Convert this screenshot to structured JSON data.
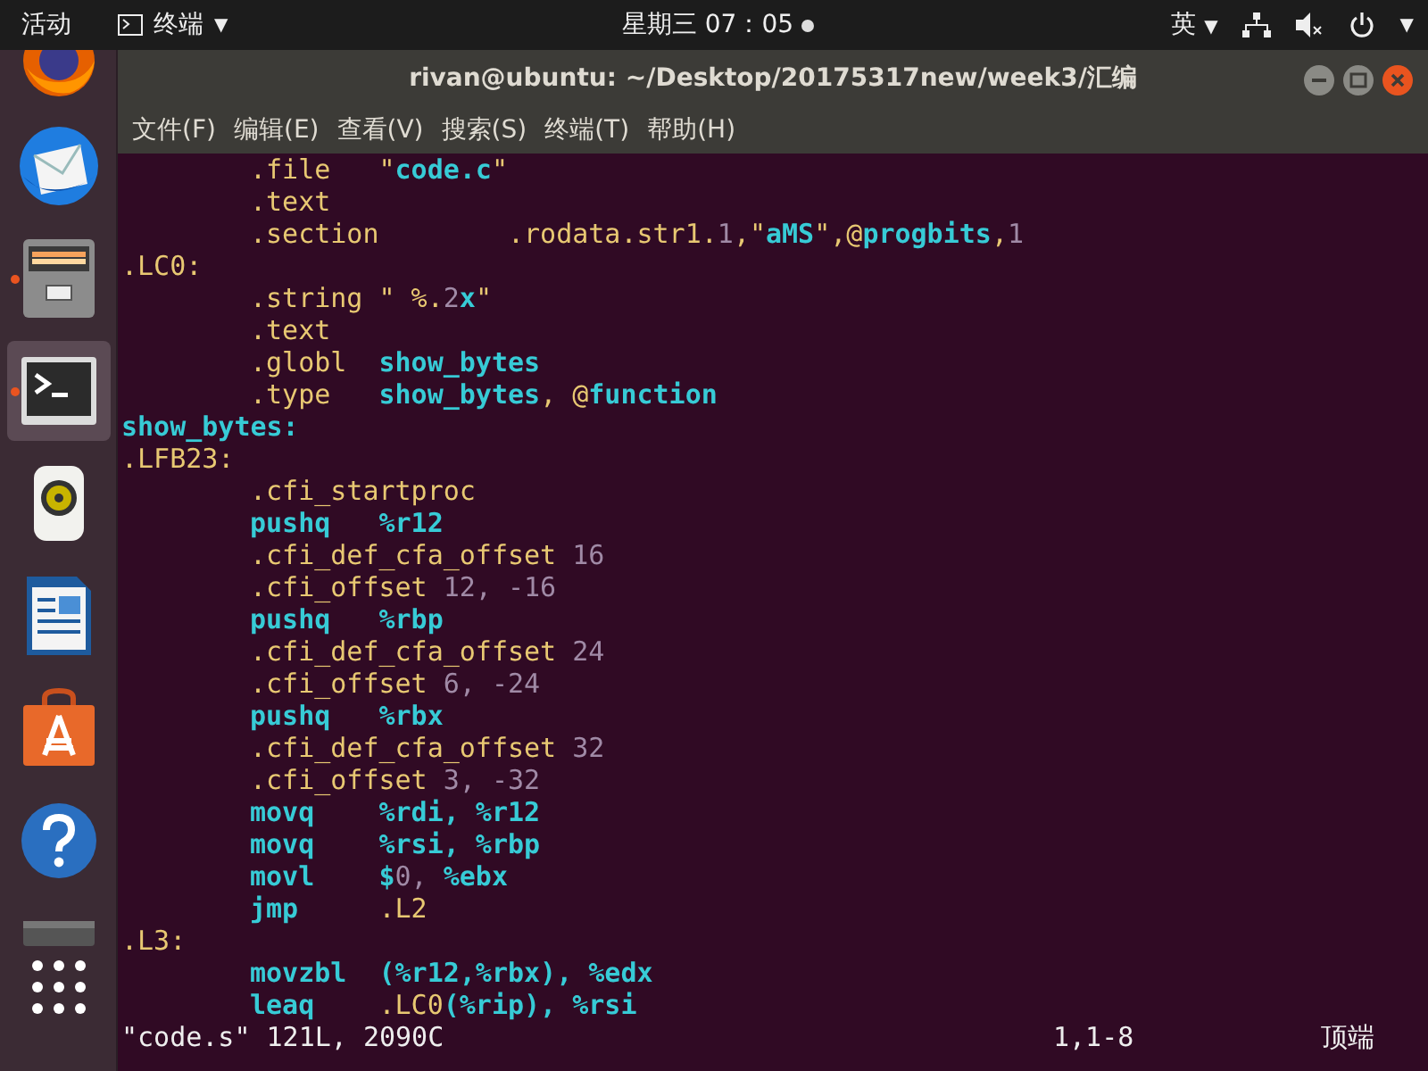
{
  "top_bar": {
    "activities": "活动",
    "app_menu": "终端",
    "app_menu_caret": "▼",
    "input_method_caret": "▼",
    "system_menu_caret": "▼",
    "clock": "星期三 07：05",
    "notification_dot": true,
    "input_method": "英"
  },
  "dock": [
    {
      "kind": "browser",
      "running": false,
      "selected": false
    },
    {
      "kind": "mail",
      "running": false,
      "selected": false
    },
    {
      "kind": "files",
      "running": true,
      "selected": false
    },
    {
      "kind": "terminal",
      "running": true,
      "selected": true
    },
    {
      "kind": "speaker",
      "running": false,
      "selected": false
    },
    {
      "kind": "document",
      "running": false,
      "selected": false
    },
    {
      "kind": "store",
      "running": false,
      "selected": false
    },
    {
      "kind": "help",
      "running": false,
      "selected": false
    },
    {
      "kind": "partial",
      "running": false,
      "selected": false
    },
    {
      "kind": "grid",
      "running": false,
      "selected": false
    }
  ],
  "window": {
    "title": "rivan@ubuntu: ~/Desktop/20175317new/week3/汇编",
    "menu": [
      "文件(F)",
      "编辑(E)",
      "查看(V)",
      "搜索(S)",
      "终端(T)",
      "帮助(H)"
    ],
    "lines": [
      {
        "indent": true,
        "segments": [
          {
            "text": ".file   \"",
            "kind": "directive"
          },
          {
            "text": "code.c",
            "kind": "ident"
          },
          {
            "text": "\"",
            "kind": "directive"
          }
        ]
      },
      {
        "indent": true,
        "segments": [
          {
            "text": ".text",
            "kind": "directive"
          }
        ]
      },
      {
        "indent": true,
        "segments": [
          {
            "text": ".section        .rodata.str1.",
            "kind": "directive"
          },
          {
            "text": "1",
            "kind": "number"
          },
          {
            "text": ",\"",
            "kind": "directive"
          },
          {
            "text": "aMS",
            "kind": "ident"
          },
          {
            "text": "\",@",
            "kind": "directive"
          },
          {
            "text": "progbits",
            "kind": "ident"
          },
          {
            "text": ",",
            "kind": "directive"
          },
          {
            "text": "1",
            "kind": "number"
          }
        ]
      },
      {
        "indent": false,
        "segments": [
          {
            "text": ".LC0:",
            "kind": "directive"
          }
        ]
      },
      {
        "indent": true,
        "segments": [
          {
            "text": ".string \" %.",
            "kind": "directive"
          },
          {
            "text": "2",
            "kind": "number"
          },
          {
            "text": "x",
            "kind": "ident"
          },
          {
            "text": "\"",
            "kind": "directive"
          }
        ]
      },
      {
        "indent": true,
        "segments": [
          {
            "text": ".text",
            "kind": "directive"
          }
        ]
      },
      {
        "indent": true,
        "segments": [
          {
            "text": ".globl  ",
            "kind": "directive"
          },
          {
            "text": "show_bytes",
            "kind": "ident"
          }
        ]
      },
      {
        "indent": true,
        "segments": [
          {
            "text": ".type   ",
            "kind": "directive"
          },
          {
            "text": "show_bytes",
            "kind": "ident"
          },
          {
            "text": ", @",
            "kind": "directive"
          },
          {
            "text": "function",
            "kind": "ident"
          }
        ]
      },
      {
        "indent": false,
        "segments": [
          {
            "text": "show_bytes:",
            "kind": "ident"
          }
        ]
      },
      {
        "indent": false,
        "segments": [
          {
            "text": ".LFB23:",
            "kind": "directive"
          }
        ]
      },
      {
        "indent": true,
        "segments": [
          {
            "text": ".cfi_startproc",
            "kind": "directive"
          }
        ]
      },
      {
        "indent": true,
        "segments": [
          {
            "text": "pushq   %r12",
            "kind": "ident"
          }
        ]
      },
      {
        "indent": true,
        "segments": [
          {
            "text": ".cfi_def_cfa_offset ",
            "kind": "directive"
          },
          {
            "text": "16",
            "kind": "number"
          }
        ]
      },
      {
        "indent": true,
        "segments": [
          {
            "text": ".cfi_offset ",
            "kind": "directive"
          },
          {
            "text": "12, -16",
            "kind": "number"
          }
        ]
      },
      {
        "indent": true,
        "segments": [
          {
            "text": "pushq   %rbp",
            "kind": "ident"
          }
        ]
      },
      {
        "indent": true,
        "segments": [
          {
            "text": ".cfi_def_cfa_offset ",
            "kind": "directive"
          },
          {
            "text": "24",
            "kind": "number"
          }
        ]
      },
      {
        "indent": true,
        "segments": [
          {
            "text": ".cfi_offset ",
            "kind": "directive"
          },
          {
            "text": "6, -24",
            "kind": "number"
          }
        ]
      },
      {
        "indent": true,
        "segments": [
          {
            "text": "pushq   %rbx",
            "kind": "ident"
          }
        ]
      },
      {
        "indent": true,
        "segments": [
          {
            "text": ".cfi_def_cfa_offset ",
            "kind": "directive"
          },
          {
            "text": "32",
            "kind": "number"
          }
        ]
      },
      {
        "indent": true,
        "segments": [
          {
            "text": ".cfi_offset ",
            "kind": "directive"
          },
          {
            "text": "3, -32",
            "kind": "number"
          }
        ]
      },
      {
        "indent": true,
        "segments": [
          {
            "text": "movq    %rdi, %r12",
            "kind": "ident"
          }
        ]
      },
      {
        "indent": true,
        "segments": [
          {
            "text": "movq    %rsi, %rbp",
            "kind": "ident"
          }
        ]
      },
      {
        "indent": true,
        "segments": [
          {
            "text": "movl    $",
            "kind": "ident"
          },
          {
            "text": "0,",
            "kind": "number"
          },
          {
            "text": " %ebx",
            "kind": "ident"
          }
        ]
      },
      {
        "indent": true,
        "segments": [
          {
            "text": "jmp     ",
            "kind": "ident"
          },
          {
            "text": ".L2",
            "kind": "directive"
          }
        ]
      },
      {
        "indent": false,
        "segments": [
          {
            "text": ".L3:",
            "kind": "directive"
          }
        ]
      },
      {
        "indent": true,
        "segments": [
          {
            "text": "movzbl  (%r12,%rbx), %edx",
            "kind": "ident"
          }
        ]
      },
      {
        "indent": true,
        "segments": [
          {
            "text": "leaq    ",
            "kind": "ident"
          },
          {
            "text": ".LC0",
            "kind": "directive"
          },
          {
            "text": "(%rip), %rsi",
            "kind": "ident"
          }
        ]
      }
    ],
    "status_line": {
      "file_info": "\"code.s\" 121L, 2090C",
      "position": "1,1-8",
      "scroll": "顶端"
    }
  }
}
